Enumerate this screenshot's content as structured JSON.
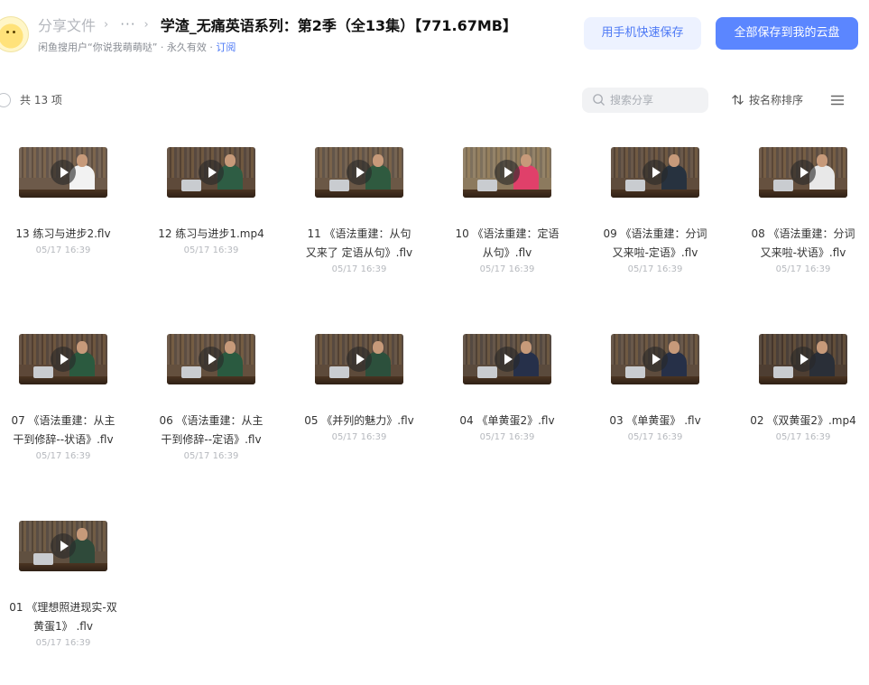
{
  "header": {
    "breadcrumb_root": "分享文件",
    "breadcrumb_sep": "›",
    "breadcrumb_more": "···",
    "title": "学渣_无痛英语系列：第2季（全13集）【771.67MB】",
    "sharer": "闲鱼搜用户“你说我萌萌哒”",
    "validity": "永久有效",
    "subscribe": "订阅",
    "dot": "·"
  },
  "actions": {
    "phone_save": "用手机快速保存",
    "save_all": "全部保存到我的云盘"
  },
  "toolbar": {
    "count": "共 13 项",
    "search_placeholder": "搜索分享",
    "sort_label": "按名称排序"
  },
  "files": [
    {
      "name": "13 练习与进步2.flv",
      "date": "05/17 16:39",
      "scene": {
        "bg": "#6d5a4a",
        "shirt": "#f2f2f2",
        "laptop": false
      }
    },
    {
      "name": "12 练习与进步1.mp4",
      "date": "05/17 16:39",
      "scene": {
        "bg": "#5e4a3a",
        "shirt": "#2e5d44",
        "laptop": true
      }
    },
    {
      "name": "11 《语法重建：从句又来了 定语从句》.flv",
      "date": "05/17 16:39",
      "scene": {
        "bg": "#6b5846",
        "shirt": "#2f5a3f",
        "laptop": true
      }
    },
    {
      "name": "10 《语法重建：定语从句》.flv",
      "date": "05/17 16:39",
      "scene": {
        "bg": "#8c7a5e",
        "shirt": "#e0406a",
        "laptop": true
      }
    },
    {
      "name": "09 《语法重建：分词又来啦-定语》.flv",
      "date": "05/17 16:39",
      "scene": {
        "bg": "#5f4c3c",
        "shirt": "#27323f",
        "laptop": true
      }
    },
    {
      "name": "08 《语法重建：分词又来啦-状语》.flv",
      "date": "05/17 16:39",
      "scene": {
        "bg": "#66513f",
        "shirt": "#e8e8e8",
        "laptop": true
      }
    },
    {
      "name": "07 《语法重建：从主干到修辞--状语》.flv",
      "date": "05/17 16:39",
      "scene": {
        "bg": "#5d4838",
        "shirt": "#2b5a3f",
        "laptop": true
      }
    },
    {
      "name": "06 《语法重建：从主干到修辞--定语》.flv",
      "date": "05/17 16:39",
      "scene": {
        "bg": "#64503e",
        "shirt": "#2a5a40",
        "laptop": true
      }
    },
    {
      "name": "05 《并列的魅力》.flv",
      "date": "05/17 16:39",
      "scene": {
        "bg": "#5d4a3a",
        "shirt": "#2c503c",
        "laptop": true
      }
    },
    {
      "name": "04 《单黄蛋2》.flv",
      "date": "05/17 16:39",
      "scene": {
        "bg": "#5a4a3c",
        "shirt": "#26304a",
        "laptop": true
      }
    },
    {
      "name": "03 《单黄蛋》 .flv",
      "date": "05/17 16:39",
      "scene": {
        "bg": "#5e4c3d",
        "shirt": "#263048",
        "laptop": true
      }
    },
    {
      "name": "02 《双黄蛋2》.mp4",
      "date": "05/17 16:39",
      "scene": {
        "bg": "#4e3e32",
        "shirt": "#2a2f38",
        "laptop": true
      }
    },
    {
      "name": "01 《理想照进现实-双黄蛋1》 .flv",
      "date": "05/17 16:39",
      "scene": {
        "bg": "#605040",
        "shirt": "#2f4a3a",
        "laptop": true
      }
    }
  ]
}
